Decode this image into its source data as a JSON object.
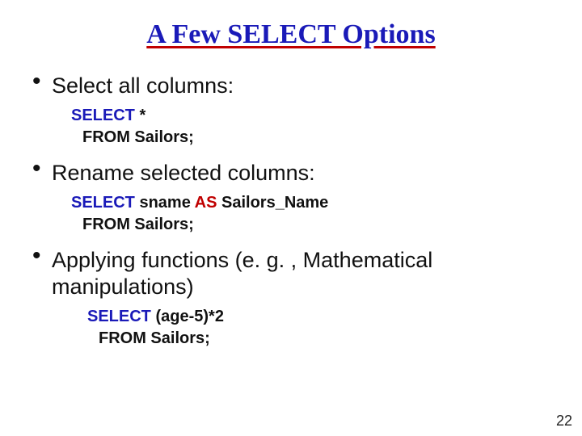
{
  "title": "A Few SELECT Options",
  "bullets": [
    {
      "text": "Select all columns:",
      "code": {
        "line1_pre": "SELECT",
        "line1_post": " *",
        "line2": "FROM Sailors;"
      }
    },
    {
      "text": "Rename selected columns:",
      "code": {
        "line1_pre": "SELECT",
        "line1_mid": " sname ",
        "line1_as": "AS",
        "line1_post": " Sailors_Name",
        "line2": "FROM Sailors;"
      }
    },
    {
      "text": "Applying functions (e. g. , Mathematical manipulations)",
      "code": {
        "line1_pre": "SELECT",
        "line1_post": " (age-5)*2",
        "line2": "FROM Sailors;"
      }
    }
  ],
  "page_number": "22"
}
